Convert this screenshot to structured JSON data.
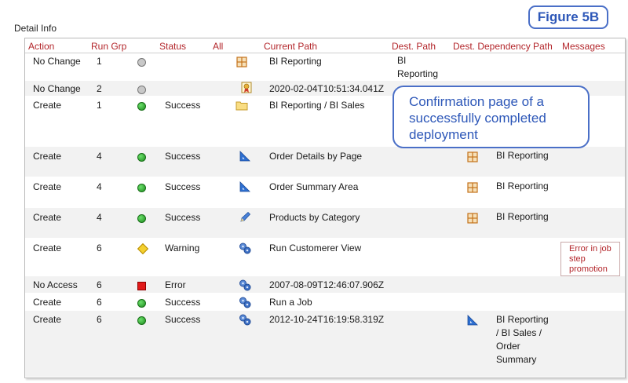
{
  "section_title": "Detail Info",
  "figure_label": "Figure 5B",
  "callout": "Confirmation page of a successfully completed deployment",
  "columns": {
    "action": "Action",
    "run_grp": "Run Grp",
    "status": "Status",
    "all": "All",
    "current_path": "Current Path",
    "dest_path": "Dest. Path",
    "dest_dependency_path": "Dest. Dependency Path",
    "messages": "Messages"
  },
  "rows": [
    {
      "action": "No Change",
      "run_grp": "1",
      "status_icon": "grey-circle-icon",
      "status": "",
      "type_icon": "report-grid-icon",
      "current_path": "BI Reporting",
      "dest_path": "BI Reporting",
      "dep_icon": "",
      "dest_dependency_path": "",
      "message": ""
    },
    {
      "action": "No Change",
      "run_grp": "2",
      "status_icon": "grey-circle-icon",
      "status": "",
      "type_icon": "certificate-icon",
      "current_path": "2020-02-04T10:51:34.041Z",
      "dest_path": "",
      "dep_icon": "",
      "dest_dependency_path": "",
      "message": ""
    },
    {
      "action": "Create",
      "run_grp": "1",
      "status_icon": "green-circle-icon",
      "status": "Success",
      "type_icon": "folder-icon",
      "current_path": "BI Reporting / BI Sales",
      "dest_path": "",
      "dep_icon": "",
      "dest_dependency_path": "",
      "message": ""
    },
    {
      "action": "Create",
      "run_grp": "4",
      "status_icon": "green-circle-icon",
      "status": "Success",
      "type_icon": "triangle-ruler-icon",
      "current_path": "Order Details by Page",
      "dest_path": "",
      "dep_icon": "report-grid-icon",
      "dest_dependency_path": "BI Reporting",
      "message": ""
    },
    {
      "action": "Create",
      "run_grp": "4",
      "status_icon": "green-circle-icon",
      "status": "Success",
      "type_icon": "triangle-ruler-icon",
      "current_path": "Order Summary Area",
      "dest_path": "",
      "dep_icon": "report-grid-icon",
      "dest_dependency_path": "BI Reporting",
      "message": ""
    },
    {
      "action": "Create",
      "run_grp": "4",
      "status_icon": "green-circle-icon",
      "status": "Success",
      "type_icon": "pencil-icon",
      "current_path": "Products by Category",
      "dest_path": "",
      "dep_icon": "report-grid-icon",
      "dest_dependency_path": "BI Reporting",
      "message": ""
    },
    {
      "action": "Create",
      "run_grp": "6",
      "status_icon": "warning-diamond-icon",
      "status": "Warning",
      "type_icon": "job-gears-icon",
      "current_path": "Run Customerer View",
      "dest_path": "",
      "dep_icon": "",
      "dest_dependency_path": "",
      "message": "Error in job step promotion"
    },
    {
      "action": "No Access",
      "run_grp": "6",
      "status_icon": "error-square-icon",
      "status": "Error",
      "type_icon": "job-gears-icon",
      "current_path": "2007-08-09T12:46:07.906Z",
      "dest_path": "",
      "dep_icon": "",
      "dest_dependency_path": "",
      "message": ""
    },
    {
      "action": "Create",
      "run_grp": "6",
      "status_icon": "green-circle-icon",
      "status": "Success",
      "type_icon": "job-gears-icon",
      "current_path": "Run a Job",
      "dest_path": "",
      "dep_icon": "",
      "dest_dependency_path": "",
      "message": ""
    },
    {
      "action": "Create",
      "run_grp": "6",
      "status_icon": "green-circle-icon",
      "status": "Success",
      "type_icon": "job-gears-icon",
      "current_path": "2012-10-24T16:19:58.319Z",
      "dest_path": "",
      "dep_icon": "triangle-ruler-icon",
      "dest_dependency_path": "BI Reporting / BI Sales / Order Summary",
      "message": ""
    }
  ],
  "colors": {
    "header_text": "#b3262b",
    "callout_blue": "#2d57b8",
    "row_alt": "#f2f2f2"
  }
}
